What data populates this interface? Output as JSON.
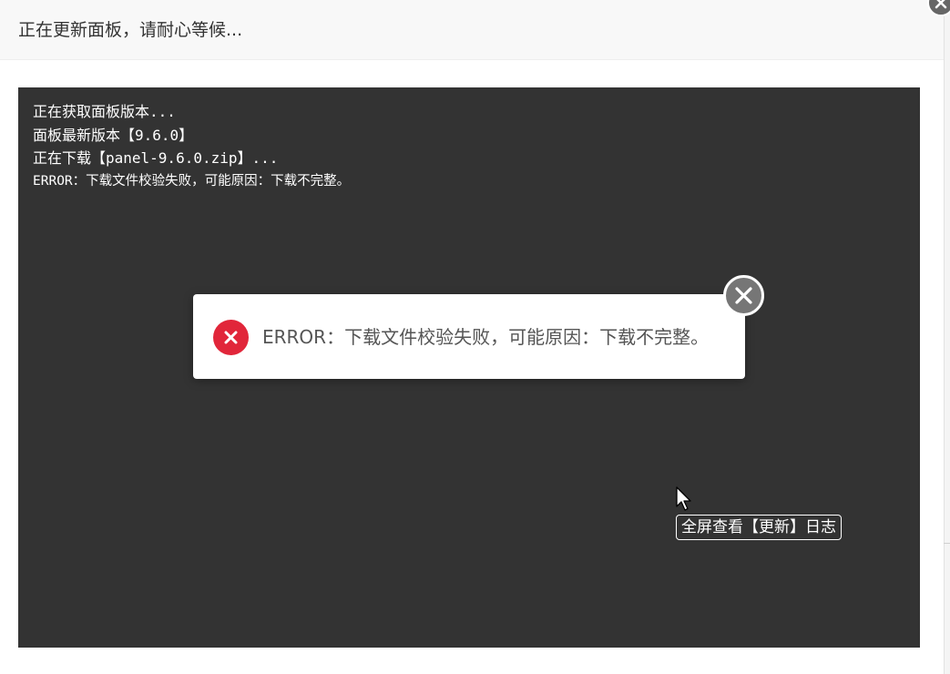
{
  "dialog": {
    "title": "正在更新面板，请耐心等候..."
  },
  "console": {
    "lines": [
      "正在获取面板版本...",
      "面板最新版本【9.6.0】",
      "正在下载【panel-9.6.0.zip】...",
      "ERROR：下载文件校验失败，可能原因：下载不完整。"
    ]
  },
  "toast": {
    "message": "ERROR：下载文件校验失败，可能原因：下载不完整。",
    "icon": "error-x-icon",
    "icon_color": "#e1263a"
  },
  "tooltip": {
    "text": "全屏查看【更新】日志"
  },
  "colors": {
    "console_bg": "#333333",
    "header_bg": "#f8f8f8",
    "close_button": "#767676"
  }
}
